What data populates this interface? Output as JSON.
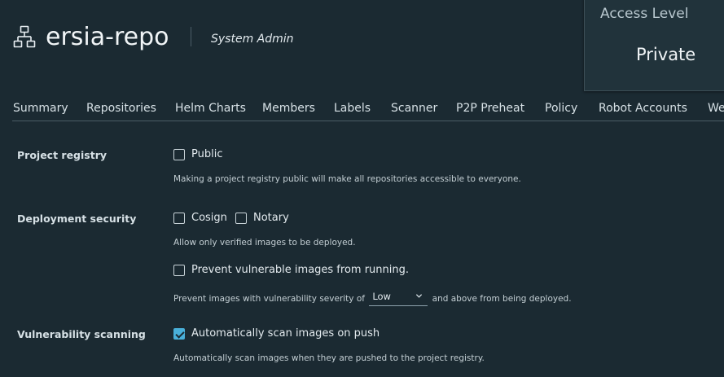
{
  "header": {
    "project_name": "ersia-repo",
    "role": "System Admin",
    "project_icon": "project-tree-icon"
  },
  "access": {
    "label": "Access Level",
    "value": "Private"
  },
  "tabs": [
    {
      "label": "Summary"
    },
    {
      "label": "Repositories"
    },
    {
      "label": "Helm Charts"
    },
    {
      "label": "Members"
    },
    {
      "label": "Labels"
    },
    {
      "label": "Scanner"
    },
    {
      "label": "P2P Preheat"
    },
    {
      "label": "Policy"
    },
    {
      "label": "Robot Accounts"
    },
    {
      "label": "We"
    }
  ],
  "config": {
    "project_registry": {
      "label": "Project registry",
      "public_label": "Public",
      "public_checked": false,
      "help": "Making a project registry public will make all repositories accessible to everyone."
    },
    "deployment_security": {
      "label": "Deployment security",
      "cosign_label": "Cosign",
      "cosign_checked": false,
      "notary_label": "Notary",
      "notary_checked": false,
      "help": "Allow only verified images to be deployed.",
      "prevent_label": "Prevent vulnerable images from running.",
      "prevent_checked": false,
      "severity_prefix": "Prevent images with vulnerability severity of",
      "severity_value": "Low",
      "severity_suffix": "and above from being deployed."
    },
    "vulnerability_scanning": {
      "label": "Vulnerability scanning",
      "auto_scan_label": "Automatically scan images on push",
      "auto_scan_checked": true,
      "help": "Automatically scan images when they are pushed to the project registry."
    }
  },
  "colors": {
    "background": "#1b2a32",
    "accent": "#49afd9",
    "card": "#21333b"
  }
}
